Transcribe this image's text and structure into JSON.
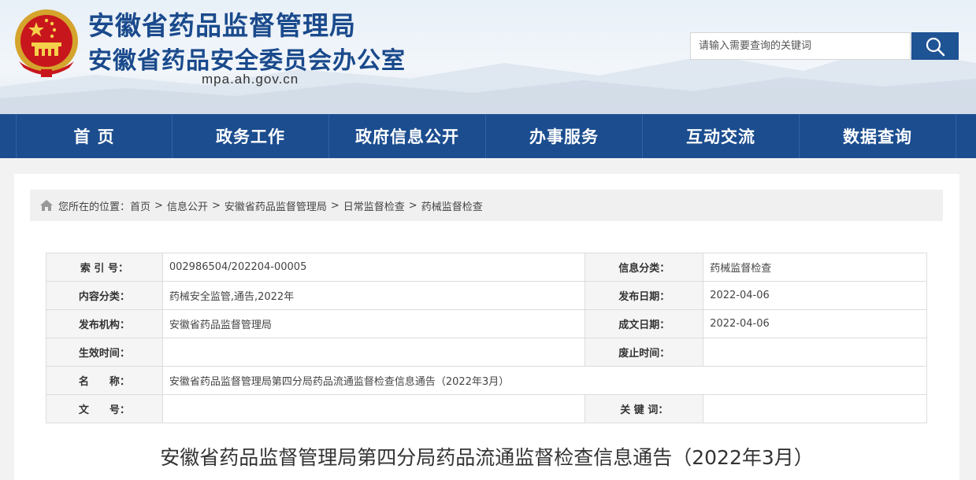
{
  "header": {
    "title_line1": "安徽省药品监督管理局",
    "title_line2": "安徽省药品安全委员会办公室",
    "domain": "mpa.ah.gov.cn",
    "search_placeholder": "请输入需要查询的关键词",
    "search_icon": "search-icon",
    "emblem_icon": "national-emblem-icon"
  },
  "nav": {
    "items": [
      "首 页",
      "政务工作",
      "政府信息公开",
      "办事服务",
      "互动交流",
      "数据查询"
    ]
  },
  "breadcrumb": {
    "icon": "home-icon",
    "prefix": "您所在的位置：",
    "items": [
      "首页",
      "信息公开",
      "安徽省药品监督管理局",
      "日常监督检查",
      "药械监督检查"
    ],
    "separator": ">"
  },
  "meta": {
    "index_label": "索 引 号：",
    "index_value": "002986504/202204-00005",
    "category_label": "信息分类：",
    "category_value": "药械监督检查",
    "content_type_label": "内容分类：",
    "content_type_value": "药械安全监管,通告,2022年",
    "publish_date_label": "发布日期：",
    "publish_date_value": "2022-04-06",
    "publisher_label": "发布机构：",
    "publisher_value": "安徽省药品监督管理局",
    "created_date_label": "成文日期：",
    "created_date_value": "2022-04-06",
    "effective_label": "生效时间：",
    "effective_value": "",
    "expire_label": "废止时间：",
    "expire_value": "",
    "name_label": "名　　称：",
    "name_value": "安徽省药品监督管理局第四分局药品流通监督检查信息通告（2022年3月）",
    "doc_no_label": "文　　号：",
    "doc_no_value": "",
    "keywords_label": "关 键 词：",
    "keywords_value": ""
  },
  "article": {
    "title": "安徽省药品监督管理局第四分局药品流通监督检查信息通告（2022年3月）"
  },
  "colors": {
    "nav_bg": "#1b4d8f",
    "title_blue": "#1a4a8c",
    "search_btn": "#1e5394"
  }
}
